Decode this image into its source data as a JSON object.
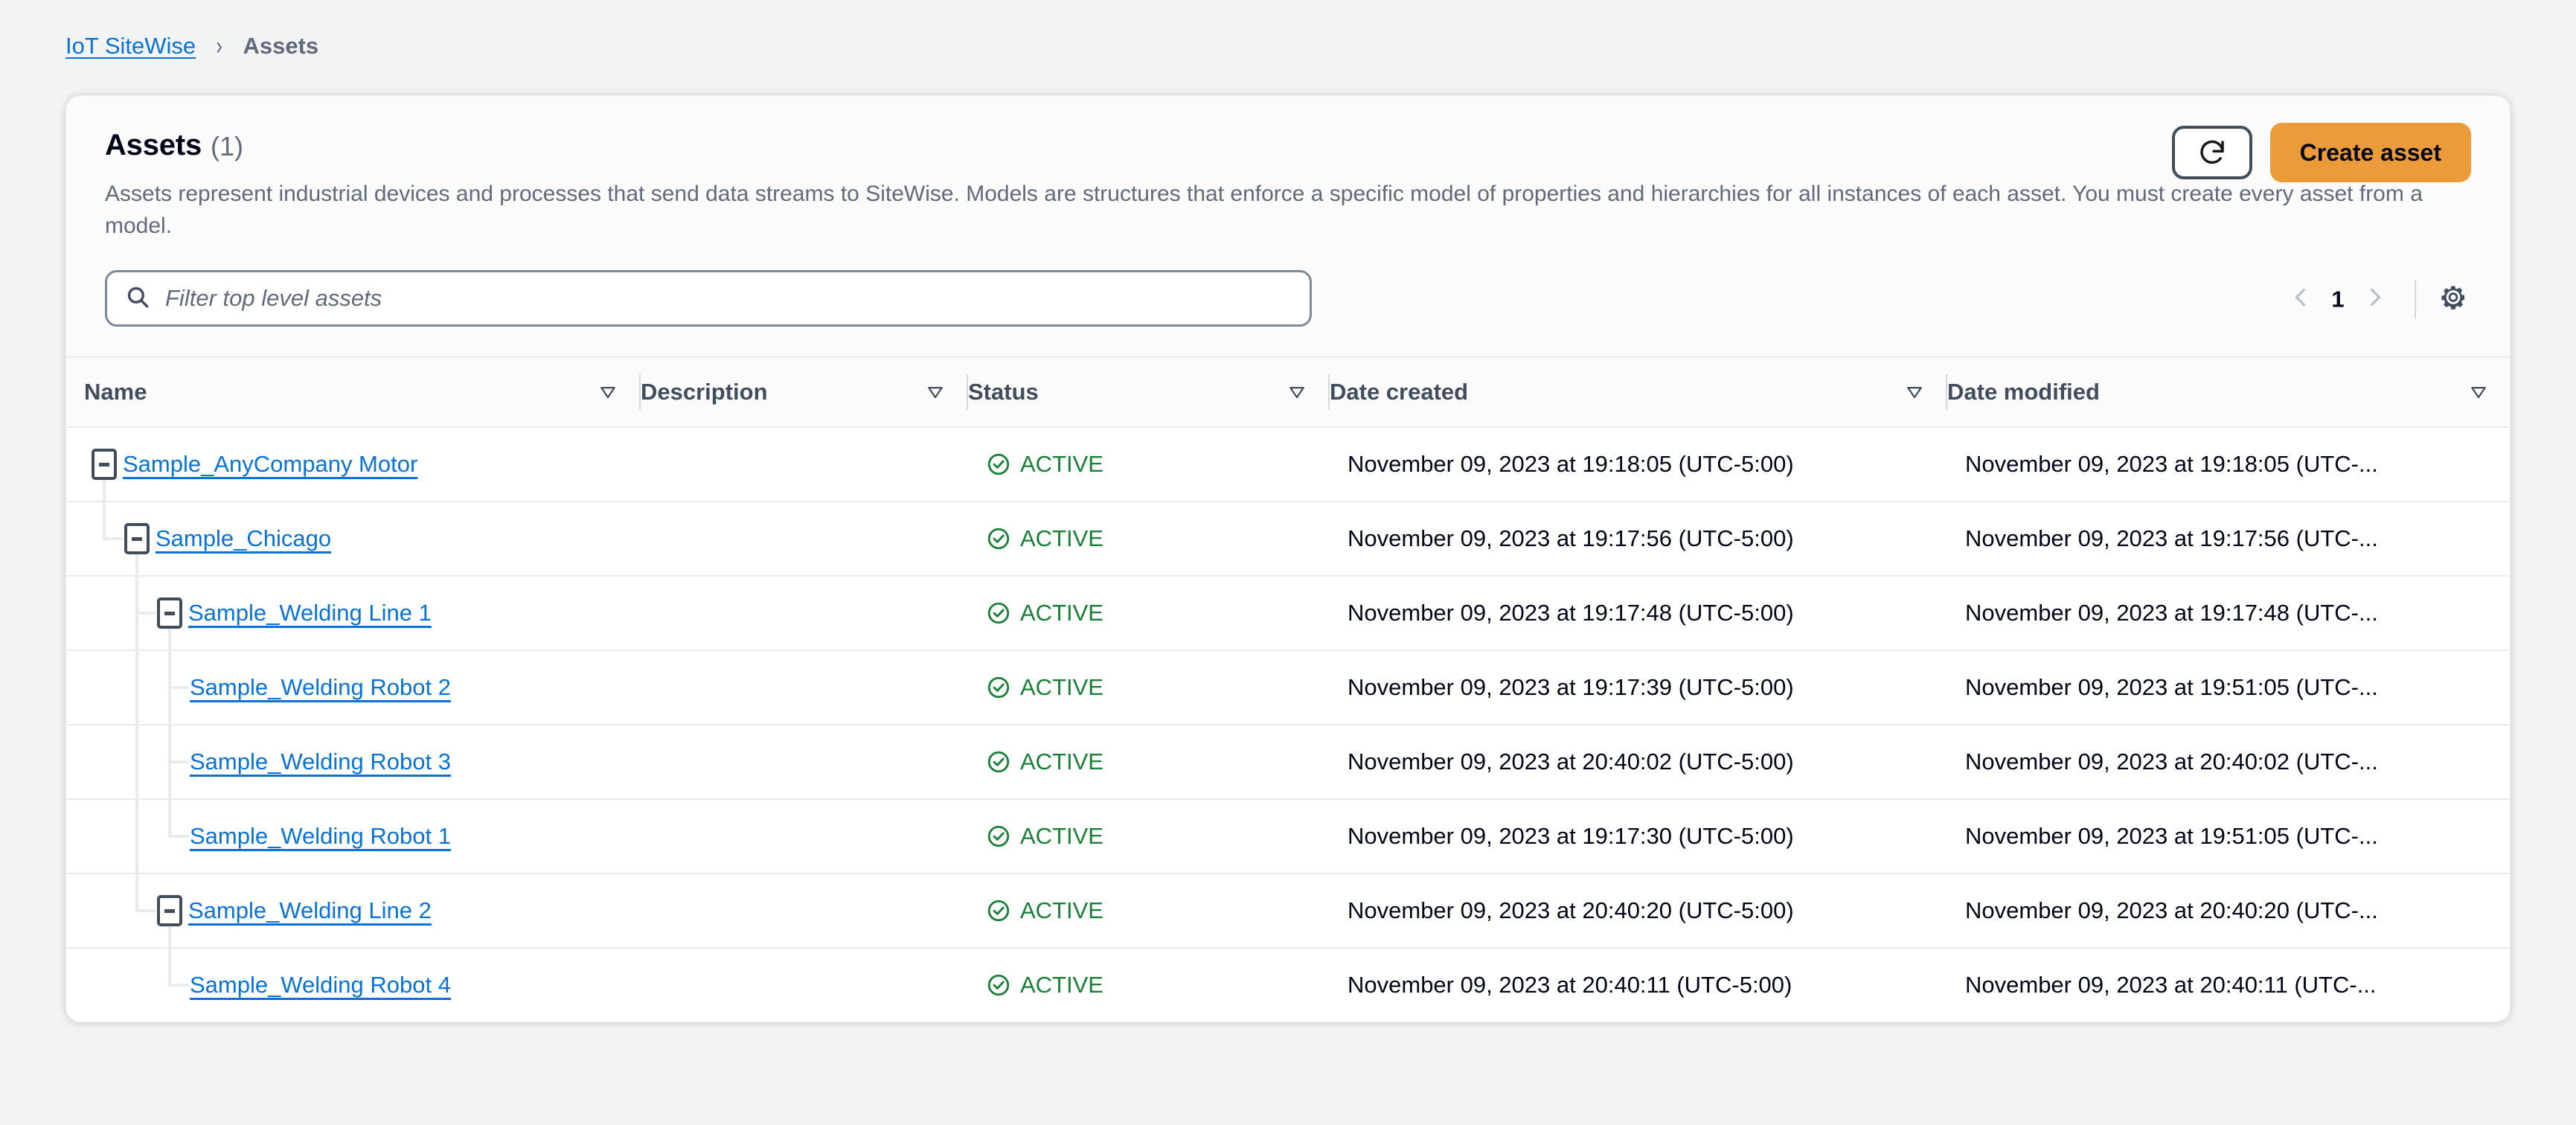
{
  "breadcrumb": {
    "root": "IoT SiteWise",
    "separator": "›",
    "current": "Assets"
  },
  "card": {
    "title": "Assets",
    "count": "(1)",
    "description": "Assets represent industrial devices and processes that send data streams to SiteWise. Models are structures that enforce a specific model of properties and hierarchies for all instances of each asset. You must create every asset from a model."
  },
  "actions": {
    "refresh_icon": "refresh-icon",
    "create_label": "Create asset",
    "primary_color": "#ec9b3b"
  },
  "search": {
    "icon": "search-icon",
    "placeholder": "Filter top level assets",
    "value": ""
  },
  "pagination": {
    "prev_icon": "chevron-left-icon",
    "page": "1",
    "next_icon": "chevron-right-icon",
    "settings_icon": "gear-icon"
  },
  "table": {
    "columns": [
      {
        "label": "Name",
        "sort_icon": "sort-descending-icon"
      },
      {
        "label": "Description",
        "sort_icon": "sort-descending-icon"
      },
      {
        "label": "Status",
        "sort_icon": "sort-descending-icon"
      },
      {
        "label": "Date created",
        "sort_icon": "sort-descending-icon"
      },
      {
        "label": "Date modified",
        "sort_icon": "sort-descending-icon"
      }
    ],
    "status_icon": "check-circle-icon",
    "status_color": "#1a7f37",
    "rows": [
      {
        "name": "Sample_AnyCompany Motor",
        "depth": 0,
        "expandable": true,
        "expanded": true,
        "last_child": false,
        "description": "",
        "status": "ACTIVE",
        "date_created": "November 09, 2023 at 19:18:05 (UTC-5:00)",
        "date_modified": "November 09, 2023 at 19:18:05 (UTC-..."
      },
      {
        "name": "Sample_Chicago",
        "depth": 1,
        "expandable": true,
        "expanded": true,
        "last_child": true,
        "description": "",
        "status": "ACTIVE",
        "date_created": "November 09, 2023 at 19:17:56 (UTC-5:00)",
        "date_modified": "November 09, 2023 at 19:17:56 (UTC-..."
      },
      {
        "name": "Sample_Welding Line 1",
        "depth": 2,
        "expandable": true,
        "expanded": true,
        "last_child": false,
        "description": "",
        "status": "ACTIVE",
        "date_created": "November 09, 2023 at 19:17:48 (UTC-5:00)",
        "date_modified": "November 09, 2023 at 19:17:48 (UTC-..."
      },
      {
        "name": "Sample_Welding Robot 2",
        "depth": 3,
        "expandable": false,
        "expanded": false,
        "last_child": false,
        "description": "",
        "status": "ACTIVE",
        "date_created": "November 09, 2023 at 19:17:39 (UTC-5:00)",
        "date_modified": "November 09, 2023 at 19:51:05 (UTC-..."
      },
      {
        "name": "Sample_Welding Robot 3",
        "depth": 3,
        "expandable": false,
        "expanded": false,
        "last_child": false,
        "description": "",
        "status": "ACTIVE",
        "date_created": "November 09, 2023 at 20:40:02 (UTC-5:00)",
        "date_modified": "November 09, 2023 at 20:40:02 (UTC-..."
      },
      {
        "name": "Sample_Welding Robot 1",
        "depth": 3,
        "expandable": false,
        "expanded": false,
        "last_child": true,
        "description": "",
        "status": "ACTIVE",
        "date_created": "November 09, 2023 at 19:17:30 (UTC-5:00)",
        "date_modified": "November 09, 2023 at 19:51:05 (UTC-..."
      },
      {
        "name": "Sample_Welding Line 2",
        "depth": 2,
        "expandable": true,
        "expanded": true,
        "last_child": true,
        "description": "",
        "status": "ACTIVE",
        "date_created": "November 09, 2023 at 20:40:20 (UTC-5:00)",
        "date_modified": "November 09, 2023 at 20:40:20 (UTC-..."
      },
      {
        "name": "Sample_Welding Robot 4",
        "depth": 3,
        "expandable": false,
        "expanded": false,
        "last_child": true,
        "description": "",
        "status": "ACTIVE",
        "date_created": "November 09, 2023 at 20:40:11 (UTC-5:00)",
        "date_modified": "November 09, 2023 at 20:40:11 (UTC-..."
      }
    ]
  }
}
